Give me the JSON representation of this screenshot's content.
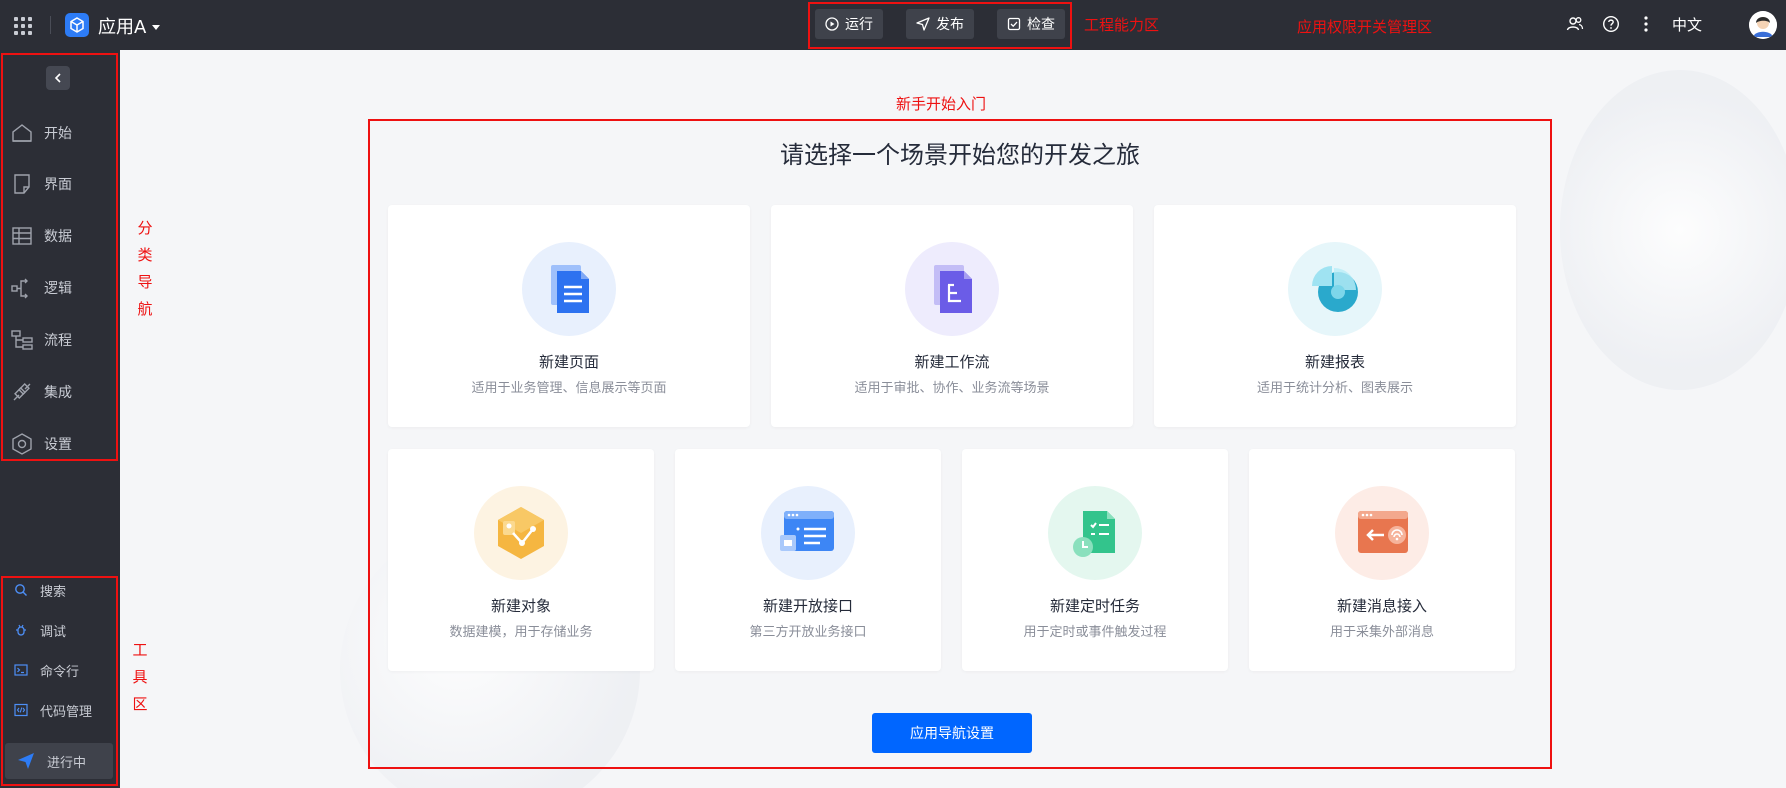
{
  "header": {
    "app_name": "应用A",
    "tools": [
      {
        "label": "运行"
      },
      {
        "label": "发布"
      },
      {
        "label": "检查"
      }
    ],
    "annot_tools": "工程能力区",
    "annot_perm": "应用权限开关管理区",
    "language": "中文"
  },
  "sidebar": {
    "items": [
      {
        "label": "开始"
      },
      {
        "label": "界面"
      },
      {
        "label": "数据"
      },
      {
        "label": "逻辑"
      },
      {
        "label": "流程"
      },
      {
        "label": "集成"
      },
      {
        "label": "设置"
      }
    ],
    "tools": [
      {
        "label": "搜索"
      },
      {
        "label": "调试"
      },
      {
        "label": "命令行"
      },
      {
        "label": "代码管理"
      }
    ],
    "running": "进行中",
    "annot_nav": [
      "分",
      "类",
      "导",
      "航"
    ],
    "annot_tools": [
      "工",
      "具",
      "区"
    ]
  },
  "main": {
    "annot_entry": "新手开始入门",
    "title": "请选择一个场景开始您的开发之旅",
    "cards_row1": [
      {
        "title": "新建页面",
        "desc": "适用于业务管理、信息展示等页面",
        "icon": "page-doc-icon"
      },
      {
        "title": "新建工作流",
        "desc": "适用于审批、协作、业务流等场景",
        "icon": "workflow-doc-icon"
      },
      {
        "title": "新建报表",
        "desc": "适用于统计分析、图表展示",
        "icon": "report-pie-icon"
      }
    ],
    "cards_row2": [
      {
        "title": "新建对象",
        "desc": "数据建模，用于存储业务",
        "icon": "object-hexagon-icon"
      },
      {
        "title": "新建开放接口",
        "desc": "第三方开放业务接口",
        "icon": "open-api-icon"
      },
      {
        "title": "新建定时任务",
        "desc": "用于定时或事件触发过程",
        "icon": "timer-task-icon"
      },
      {
        "title": "新建消息接入",
        "desc": "用于采集外部消息",
        "icon": "message-inbound-icon"
      }
    ],
    "nav_button": "应用导航设置"
  },
  "colors": {
    "topbar": "#2c2e36",
    "primary": "#0066ff",
    "annotation": "#ee1111"
  }
}
